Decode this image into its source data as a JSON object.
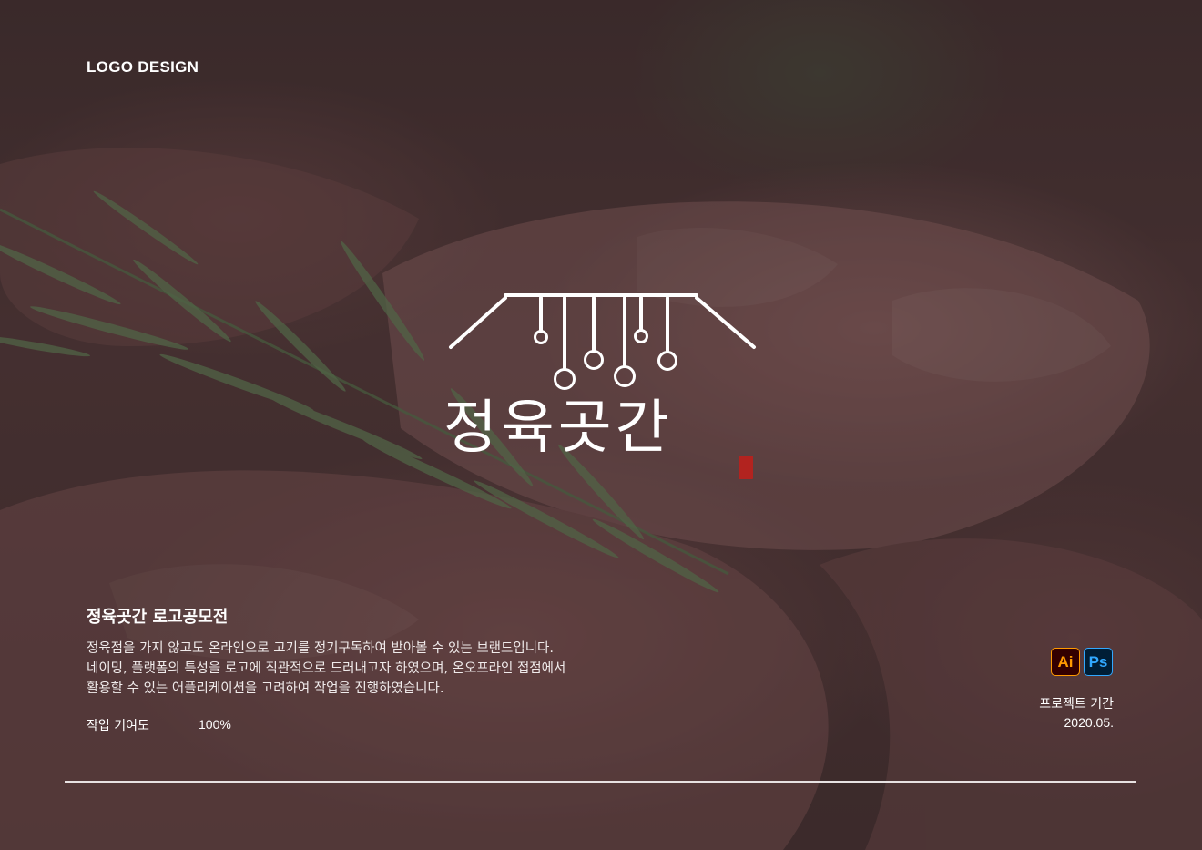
{
  "header": {
    "section_label": "LOGO DESIGN"
  },
  "logo": {
    "wordmark": "정육곳간",
    "seal_text": "정육곳간"
  },
  "project": {
    "title": "정육곳간 로고공모전",
    "description": [
      "정육점을 가지 않고도 온라인으로 고기를 정기구독하여 받아볼 수 있는 브랜드입니다.",
      "네이밍, 플랫폼의 특성을 로고에 직관적으로 드러내고자 하였으며, 온오프라인 접점에서",
      "활용할 수 있는 어플리케이션을 고려하여 작업을 진행하였습니다."
    ],
    "contribution_label": "작업 기여도",
    "contribution_value": "100%"
  },
  "tools": [
    {
      "name": "Ai",
      "icon": "illustrator-icon",
      "color": "#ff9a00"
    },
    {
      "name": "Ps",
      "icon": "photoshop-icon",
      "color": "#31a8ff"
    }
  ],
  "period": {
    "label": "프로젝트 기간",
    "value": "2020.05."
  },
  "colors": {
    "text": "#ffffff",
    "seal": "#b2231f",
    "divider": "#e8e2e2"
  }
}
